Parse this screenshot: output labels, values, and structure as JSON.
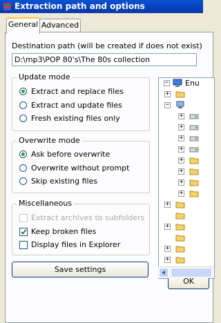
{
  "window": {
    "title": "Extraction path and options"
  },
  "tabs": [
    {
      "label": "General",
      "active": true
    },
    {
      "label": "Advanced",
      "active": false
    }
  ],
  "destination": {
    "label": "Destination path (will be created if does not exist)",
    "value": "D:\\mp3\\POP 80's\\The 80s collection"
  },
  "update_mode": {
    "title": "Update mode",
    "options": [
      {
        "label": "Extract and replace files",
        "selected": true
      },
      {
        "label": "Extract and update files",
        "selected": false
      },
      {
        "label": "Fresh existing files only",
        "selected": false
      }
    ]
  },
  "overwrite_mode": {
    "title": "Overwrite mode",
    "options": [
      {
        "label": "Ask before overwrite",
        "selected": true
      },
      {
        "label": "Overwrite without prompt",
        "selected": false
      },
      {
        "label": "Skip existing files",
        "selected": false
      }
    ]
  },
  "misc": {
    "title": "Miscellaneous",
    "options": [
      {
        "label": "Extract archives to subfolders",
        "checked": false,
        "disabled": true
      },
      {
        "label": "Keep broken files",
        "checked": true,
        "disabled": false
      },
      {
        "label": "Display files in Explorer",
        "checked": false,
        "disabled": false
      }
    ]
  },
  "buttons": {
    "save": "Save settings",
    "ok": "OK"
  },
  "tree": {
    "root_label": "Enu",
    "icons": [
      "desktop-icon",
      "folder-icon",
      "computer-icon",
      "drive-icon",
      "drive-icon",
      "drive-icon",
      "drive-icon",
      "folder-icon",
      "folder-icon",
      "folder-icon",
      "folder-icon",
      "folder-icon",
      "folder-icon",
      "folder-icon",
      "folder-icon",
      "folder-icon",
      "folder-icon",
      "folder-icon"
    ]
  },
  "colors": {
    "titlebar": "#0a53d4",
    "tab_highlight": "#ffc83c",
    "radio_dot": "#21a121",
    "folder": "#f5d36b",
    "background": "#ece9d8"
  }
}
